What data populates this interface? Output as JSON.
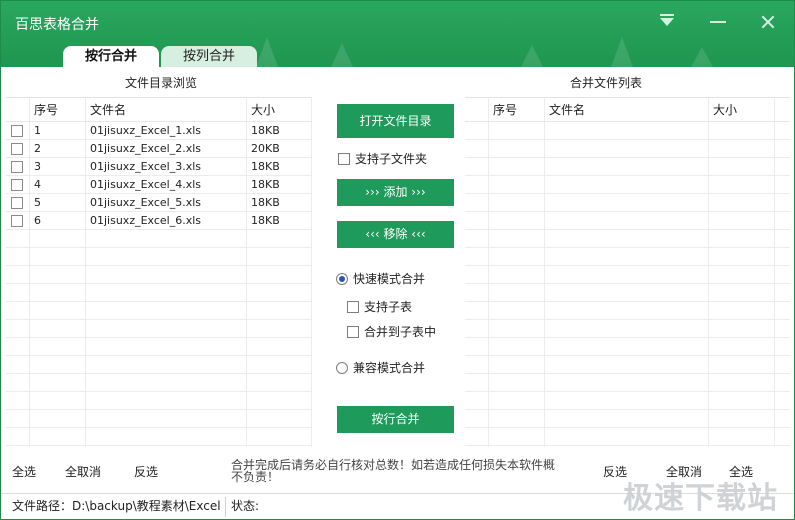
{
  "window": {
    "title": "百思表格合并",
    "tabs": [
      {
        "label": "按行合并",
        "active": true
      },
      {
        "label": "按列合并",
        "active": false
      }
    ]
  },
  "left_panel": {
    "caption": "文件目录浏览",
    "columns": [
      "序号",
      "文件名",
      "大小"
    ],
    "rows": [
      {
        "index": "1",
        "name": "01jisuxz_Excel_1.xls",
        "size": "18KB"
      },
      {
        "index": "2",
        "name": "01jisuxz_Excel_2.xls",
        "size": "20KB"
      },
      {
        "index": "3",
        "name": "01jisuxz_Excel_3.xls",
        "size": "18KB"
      },
      {
        "index": "4",
        "name": "01jisuxz_Excel_4.xls",
        "size": "18KB"
      },
      {
        "index": "5",
        "name": "01jisuxz_Excel_5.xls",
        "size": "18KB"
      },
      {
        "index": "6",
        "name": "01jisuxz_Excel_6.xls",
        "size": "18KB"
      }
    ]
  },
  "right_panel": {
    "caption": "合并文件列表",
    "columns": [
      "序号",
      "文件名",
      "大小"
    ]
  },
  "controls": {
    "open_dir": "打开文件目录",
    "include_subfolders": "支持子文件夹",
    "add": "››› 添加 ›››",
    "remove": "‹‹‹ 移除 ‹‹‹",
    "fast_mode": "快速模式合并",
    "support_sub_sheet": "支持子表",
    "merge_into_sub_sheet": "合并到子表中",
    "compat_mode": "兼容模式合并",
    "merge_button": "按行合并"
  },
  "bottom": {
    "left_select_all": "全选",
    "left_select_none": "全取消",
    "left_invert": "反选",
    "notice": "合并完成后请务必自行核对总数！如若造成任何损失本软件概不负责！",
    "right_invert": "反选",
    "right_select_none": "全取消",
    "right_select_all": "全选"
  },
  "statusbar": {
    "path_label": "文件路径：D:\\backup\\教程素材\\Excel",
    "status_label": "状态:"
  },
  "watermark": "极速下载站"
}
